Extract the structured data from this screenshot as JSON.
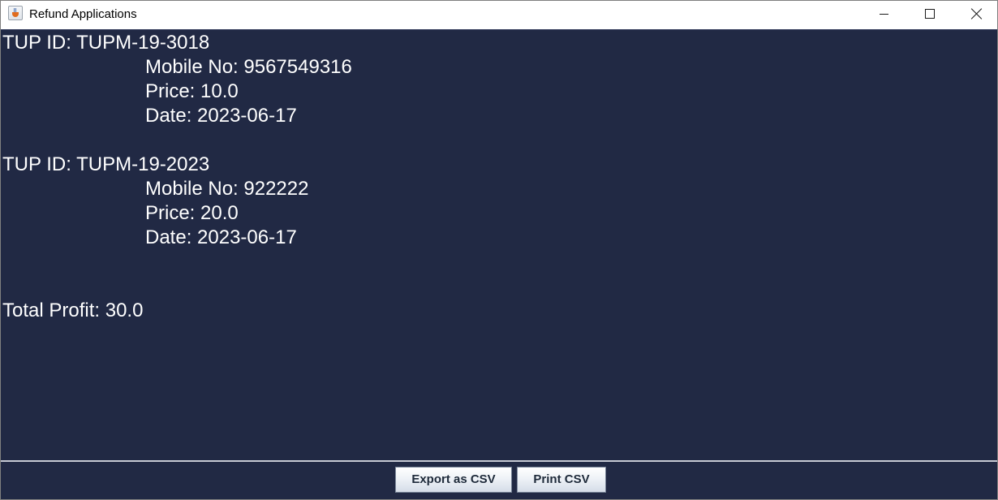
{
  "window": {
    "title": "Refund Applications",
    "controls": {
      "minimize": "minimize-icon",
      "maximize": "maximize-icon",
      "close": "close-icon"
    }
  },
  "records": [
    {
      "tup_id": "TUP ID: TUPM-19-3018",
      "mobile": "Mobile No: 9567549316",
      "price": "Price: 10.0",
      "date": "Date: 2023-06-17"
    },
    {
      "tup_id": "TUP ID: TUPM-19-2023",
      "mobile": "Mobile No: 922222",
      "price": "Price: 20.0",
      "date": "Date: 2023-06-17"
    }
  ],
  "summary": {
    "total_profit": "Total Profit: 30.0"
  },
  "actions": {
    "export_label": "Export as CSV",
    "print_label": "Print CSV"
  },
  "colors": {
    "background": "#212944",
    "text": "#ffffff"
  }
}
